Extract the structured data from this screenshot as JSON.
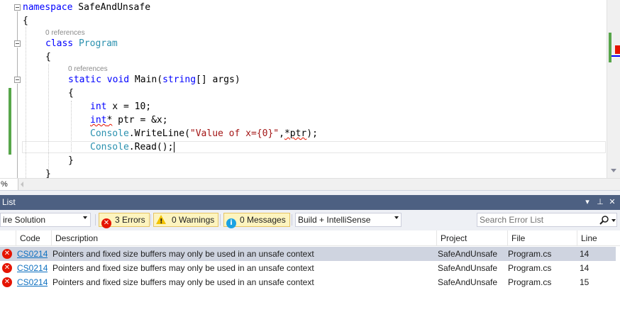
{
  "editor": {
    "codelens": [
      "0 references",
      "0 references"
    ],
    "lines": {
      "ns_kw": "namespace",
      "ns_name": " SafeAndUnsafe",
      "brace_open": "{",
      "brace_close": "}",
      "class_kw": "class",
      "class_name": "Program",
      "static_kw": "static",
      "void_kw": "void",
      "main_name": " Main(",
      "string_kw": "string",
      "main_args": "[] args)",
      "int_kw": "int",
      "line_x_rest": " x = 10;",
      "int_ptr_kw": "int",
      "int_ptr_star": "*",
      "line_ptr_rest": " ptr = &x;",
      "console1": "Console",
      "writeline": ".WriteLine(",
      "wl_string": "\"Value of x={0}\"",
      "wl_comma": ",",
      "wl_ptr": "*ptr",
      "wl_end": ");",
      "console2": "Console",
      "read": ".Read();"
    }
  },
  "hscroll": {
    "zoom": "%"
  },
  "panel": {
    "title": "List",
    "title_buttons": {
      "dropdown": "▾",
      "pin": "⊥",
      "close": "✕"
    },
    "toolbar": {
      "scope": "ire Solution",
      "errors": "3 Errors",
      "warnings": "0 Warnings",
      "messages": "0 Messages",
      "build_filter": "Build + IntelliSense",
      "search_placeholder": "Search Error List"
    },
    "columns": [
      "Code",
      "Description",
      "Project",
      "File",
      "Line"
    ],
    "rows": [
      {
        "code": "CS0214",
        "description": "Pointers and fixed size buffers may only be used in an unsafe context",
        "project": "SafeAndUnsafe",
        "file": "Program.cs",
        "line": "14"
      },
      {
        "code": "CS0214",
        "description": "Pointers and fixed size buffers may only be used in an unsafe context",
        "project": "SafeAndUnsafe",
        "file": "Program.cs",
        "line": "14"
      },
      {
        "code": "CS0214",
        "description": "Pointers and fixed size buffers may only be used in an unsafe context",
        "project": "SafeAndUnsafe",
        "file": "Program.cs",
        "line": "15"
      }
    ]
  },
  "colors": {
    "keyword": "#0000ff",
    "type": "#2b91af",
    "string": "#a31515",
    "error": "#e51400",
    "panel_title": "#4d6082",
    "link": "#0e70c0"
  },
  "icons": [
    "collapse-icon",
    "error-icon",
    "warning-icon",
    "message-icon",
    "search-icon",
    "pin-icon",
    "close-icon",
    "dropdown-icon"
  ]
}
